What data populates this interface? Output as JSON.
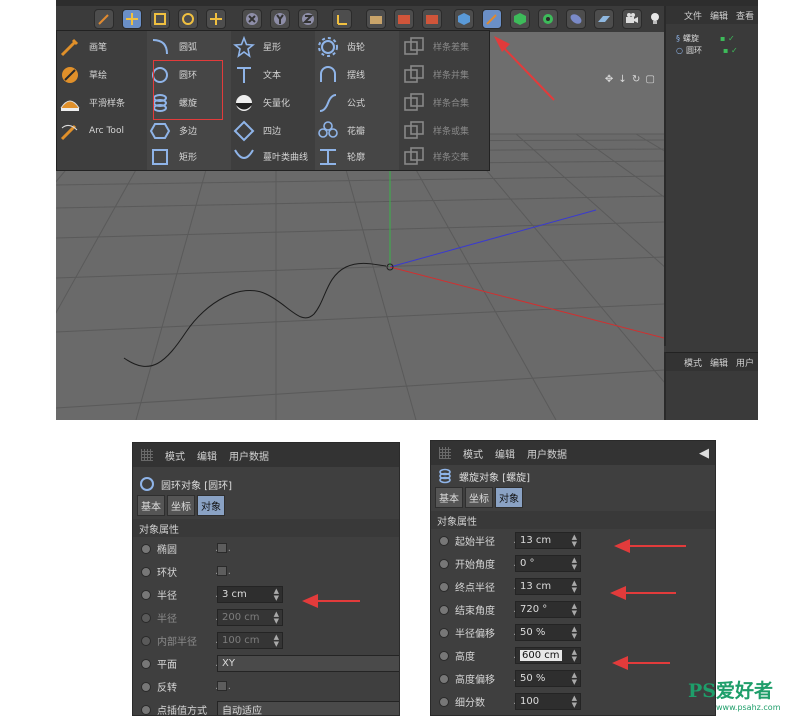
{
  "spline_menu": {
    "col1": [
      "画笔",
      "草绘",
      "平滑样条",
      "Arc Tool"
    ],
    "col2": [
      "圆弧",
      "圆环",
      "螺旋",
      "多边",
      "矩形"
    ],
    "col3": [
      "星形",
      "文本",
      "矢量化",
      "四边",
      "蔓叶类曲线"
    ],
    "col4": [
      "齿轮",
      "摆线",
      "公式",
      "花瓣",
      "轮廓"
    ],
    "col5": [
      "样条差集",
      "样条并集",
      "样条合集",
      "样条或集",
      "样条交集"
    ]
  },
  "object_manager": {
    "menu": [
      "文件",
      "编辑",
      "查看"
    ],
    "objects": [
      "螺旋",
      "圆环"
    ]
  },
  "mini_attr": {
    "menu": [
      "模式",
      "编辑",
      "用户"
    ]
  },
  "panel_left": {
    "menu": [
      "模式",
      "编辑",
      "用户数据"
    ],
    "title": "圆环对象 [圆环]",
    "tabs": [
      "基本",
      "坐标",
      "对象"
    ],
    "section": "对象属性",
    "rows": {
      "ellipse": "椭圆",
      "ring": "环状",
      "radius": "半径",
      "radius_value": "3 cm",
      "radius2": "半径",
      "radius2_value": "200 cm",
      "inner": "内部半径",
      "inner_value": "100 cm",
      "plane": "平面",
      "plane_value": "XY",
      "reverse": "反转",
      "interp": "点插值方式",
      "interp_value": "自动适应"
    }
  },
  "panel_right": {
    "menu": [
      "模式",
      "编辑",
      "用户数据"
    ],
    "title": "螺旋对象 [螺旋]",
    "tabs": [
      "基本",
      "坐标",
      "对象"
    ],
    "section": "对象属性",
    "rows": [
      {
        "label": "起始半径",
        "value": "13 cm"
      },
      {
        "label": "开始角度",
        "value": "0 °"
      },
      {
        "label": "终点半径",
        "value": "13 cm"
      },
      {
        "label": "结束角度",
        "value": "720 °"
      },
      {
        "label": "半径偏移",
        "value": "50 %"
      },
      {
        "label": "高度",
        "value": "600 cm"
      },
      {
        "label": "高度偏移",
        "value": "50 %"
      },
      {
        "label": "细分数",
        "value": "100"
      }
    ]
  },
  "watermark": {
    "main": "PS爱好者",
    "url": "www.psahz.com"
  },
  "colors": {
    "accent_red": "#e23b3b",
    "tab_active": "#8aa2c4",
    "viewport": "#6b6b6b"
  }
}
